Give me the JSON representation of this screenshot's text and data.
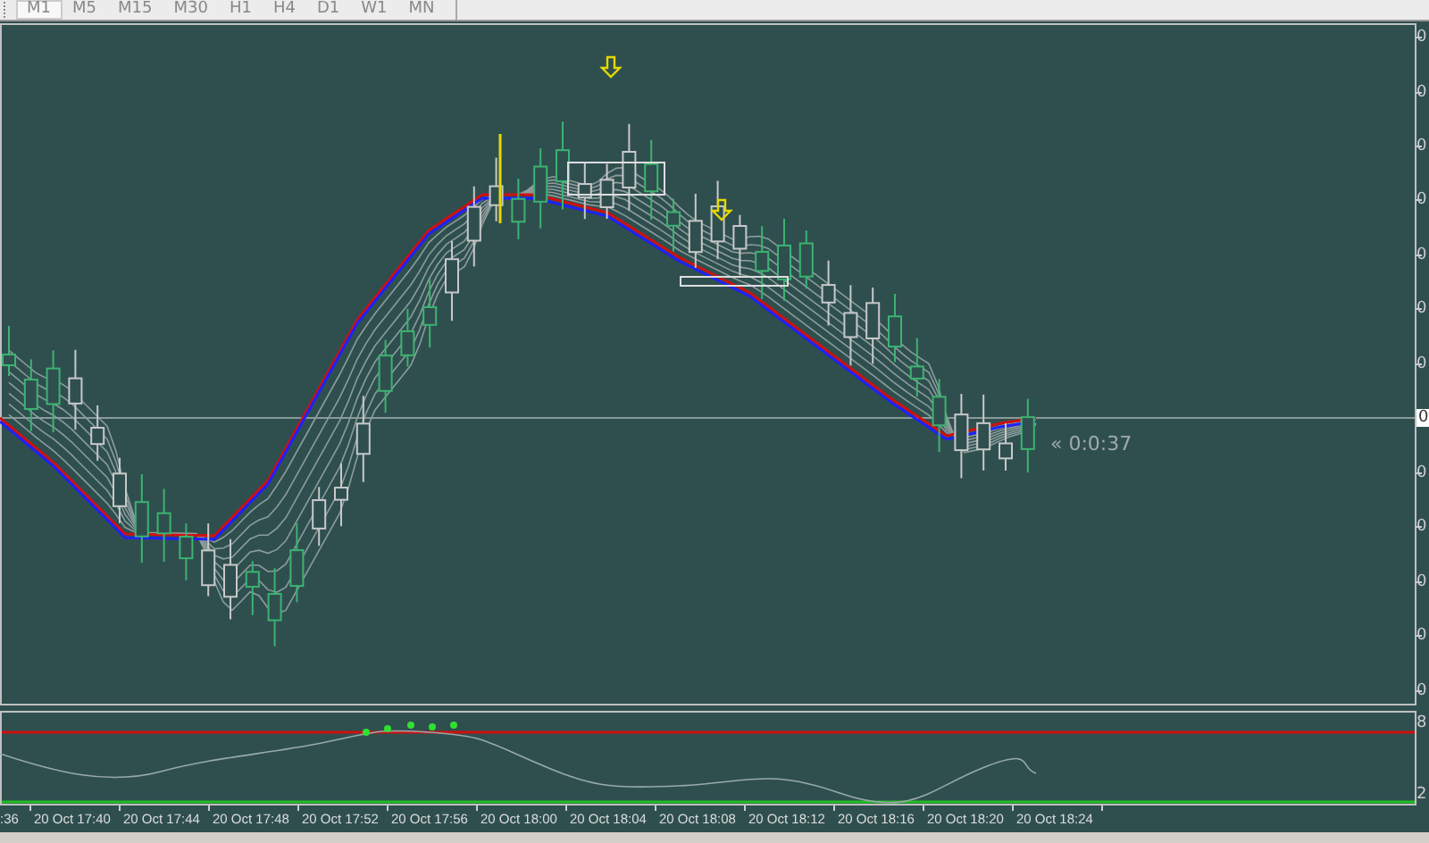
{
  "timeframes": [
    {
      "label": "M1",
      "selected": true
    },
    {
      "label": "M5",
      "selected": false
    },
    {
      "label": "M15",
      "selected": false
    },
    {
      "label": "M30",
      "selected": false
    },
    {
      "label": "H1",
      "selected": false
    },
    {
      "label": "H4",
      "selected": false
    },
    {
      "label": "D1",
      "selected": false
    },
    {
      "label": "W1",
      "selected": false
    },
    {
      "label": "MN",
      "selected": false
    }
  ],
  "price_axis": {
    "labels": [
      "0",
      "0",
      "0",
      "0",
      "0",
      "0",
      "0",
      "0",
      "0",
      "0",
      "0",
      "0"
    ],
    "current_price": "0"
  },
  "timer": "« 0:0:37",
  "indicator_axis": {
    "labels": [
      "8",
      "2"
    ]
  },
  "time_axis": {
    "labels": [
      ":36",
      "20 Oct 17:40",
      "20 Oct 17:44",
      "20 Oct 17:48",
      "20 Oct 17:52",
      "20 Oct 17:56",
      "20 Oct 18:00",
      "20 Oct 18:04",
      "20 Oct 18:08",
      "20 Oct 18:12",
      "20 Oct 18:16",
      "20 Oct 18:20",
      "20 Oct 18:24"
    ]
  }
}
